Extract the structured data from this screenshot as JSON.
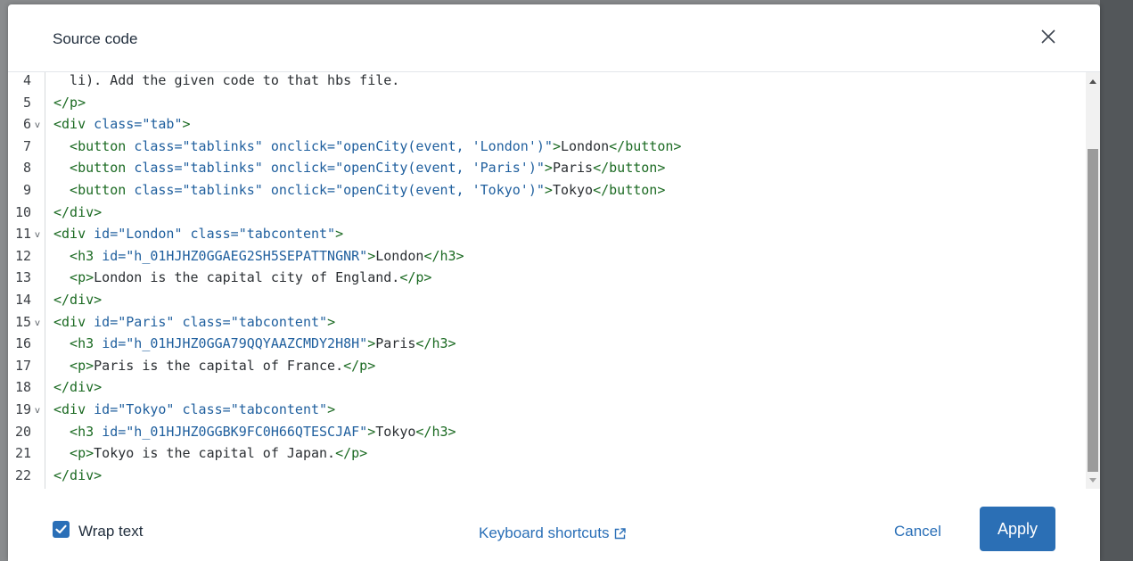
{
  "dialog": {
    "title": "Source code"
  },
  "editor": {
    "lines": [
      {
        "n": "4",
        "fold": false,
        "parts": [
          [
            "tx",
            "  li). Add the given code to that hbs file."
          ]
        ]
      },
      {
        "n": "5",
        "fold": false,
        "parts": [
          [
            "tg",
            "</p>"
          ]
        ]
      },
      {
        "n": "6",
        "fold": true,
        "parts": [
          [
            "tg",
            "<div "
          ],
          [
            "at",
            "class="
          ],
          [
            "vl",
            "\"tab\""
          ],
          [
            "tg",
            ">"
          ]
        ]
      },
      {
        "n": "7",
        "fold": false,
        "parts": [
          [
            "tg",
            "  <button "
          ],
          [
            "at",
            "class="
          ],
          [
            "vl",
            "\"tablinks\" "
          ],
          [
            "at",
            "onclick="
          ],
          [
            "vl",
            "\"openCity(event, 'London')\""
          ],
          [
            "tg",
            ">"
          ],
          [
            "tx",
            "London"
          ],
          [
            "tg",
            "</button>"
          ]
        ]
      },
      {
        "n": "8",
        "fold": false,
        "parts": [
          [
            "tg",
            "  <button "
          ],
          [
            "at",
            "class="
          ],
          [
            "vl",
            "\"tablinks\" "
          ],
          [
            "at",
            "onclick="
          ],
          [
            "vl",
            "\"openCity(event, 'Paris')\""
          ],
          [
            "tg",
            ">"
          ],
          [
            "tx",
            "Paris"
          ],
          [
            "tg",
            "</button>"
          ]
        ]
      },
      {
        "n": "9",
        "fold": false,
        "parts": [
          [
            "tg",
            "  <button "
          ],
          [
            "at",
            "class="
          ],
          [
            "vl",
            "\"tablinks\" "
          ],
          [
            "at",
            "onclick="
          ],
          [
            "vl",
            "\"openCity(event, 'Tokyo')\""
          ],
          [
            "tg",
            ">"
          ],
          [
            "tx",
            "Tokyo"
          ],
          [
            "tg",
            "</button>"
          ]
        ]
      },
      {
        "n": "10",
        "fold": false,
        "parts": [
          [
            "tg",
            "</div>"
          ]
        ]
      },
      {
        "n": "11",
        "fold": true,
        "parts": [
          [
            "tg",
            "<div "
          ],
          [
            "at",
            "id="
          ],
          [
            "vl",
            "\"London\" "
          ],
          [
            "at",
            "class="
          ],
          [
            "vl",
            "\"tabcontent\""
          ],
          [
            "tg",
            ">"
          ]
        ]
      },
      {
        "n": "12",
        "fold": false,
        "parts": [
          [
            "tg",
            "  <h3 "
          ],
          [
            "at",
            "id="
          ],
          [
            "vl",
            "\"h_01HJHZ0GGAEG2SH5SEPATTNGNR\""
          ],
          [
            "tg",
            ">"
          ],
          [
            "tx",
            "London"
          ],
          [
            "tg",
            "</h3>"
          ]
        ]
      },
      {
        "n": "13",
        "fold": false,
        "parts": [
          [
            "tg",
            "  <p>"
          ],
          [
            "tx",
            "London is the capital city of England."
          ],
          [
            "tg",
            "</p>"
          ]
        ]
      },
      {
        "n": "14",
        "fold": false,
        "parts": [
          [
            "tg",
            "</div>"
          ]
        ]
      },
      {
        "n": "15",
        "fold": true,
        "parts": [
          [
            "tg",
            "<div "
          ],
          [
            "at",
            "id="
          ],
          [
            "vl",
            "\"Paris\" "
          ],
          [
            "at",
            "class="
          ],
          [
            "vl",
            "\"tabcontent\""
          ],
          [
            "tg",
            ">"
          ]
        ]
      },
      {
        "n": "16",
        "fold": false,
        "parts": [
          [
            "tg",
            "  <h3 "
          ],
          [
            "at",
            "id="
          ],
          [
            "vl",
            "\"h_01HJHZ0GGA79QQYAAZCMDY2H8H\""
          ],
          [
            "tg",
            ">"
          ],
          [
            "tx",
            "Paris"
          ],
          [
            "tg",
            "</h3>"
          ]
        ]
      },
      {
        "n": "17",
        "fold": false,
        "parts": [
          [
            "tg",
            "  <p>"
          ],
          [
            "tx",
            "Paris is the capital of France."
          ],
          [
            "tg",
            "</p>"
          ]
        ]
      },
      {
        "n": "18",
        "fold": false,
        "parts": [
          [
            "tg",
            "</div>"
          ]
        ]
      },
      {
        "n": "19",
        "fold": true,
        "parts": [
          [
            "tg",
            "<div "
          ],
          [
            "at",
            "id="
          ],
          [
            "vl",
            "\"Tokyo\" "
          ],
          [
            "at",
            "class="
          ],
          [
            "vl",
            "\"tabcontent\""
          ],
          [
            "tg",
            ">"
          ]
        ]
      },
      {
        "n": "20",
        "fold": false,
        "parts": [
          [
            "tg",
            "  <h3 "
          ],
          [
            "at",
            "id="
          ],
          [
            "vl",
            "\"h_01HJHZ0GGBK9FC0H66QTESCJAF\""
          ],
          [
            "tg",
            ">"
          ],
          [
            "tx",
            "Tokyo"
          ],
          [
            "tg",
            "</h3>"
          ]
        ]
      },
      {
        "n": "21",
        "fold": false,
        "parts": [
          [
            "tg",
            "  <p>"
          ],
          [
            "tx",
            "Tokyo is the capital of Japan."
          ],
          [
            "tg",
            "</p>"
          ]
        ]
      },
      {
        "n": "22",
        "fold": false,
        "parts": [
          [
            "tg",
            "</div>"
          ]
        ]
      }
    ]
  },
  "footer": {
    "wrap_label": "Wrap text",
    "wrap_checked": true,
    "keyboard_label": "Keyboard shortcuts",
    "cancel_label": "Cancel",
    "apply_label": "Apply"
  },
  "colors": {
    "accent": "#2b6fb5",
    "tag": "#1b6a22",
    "attribute": "#1f5f9e"
  }
}
